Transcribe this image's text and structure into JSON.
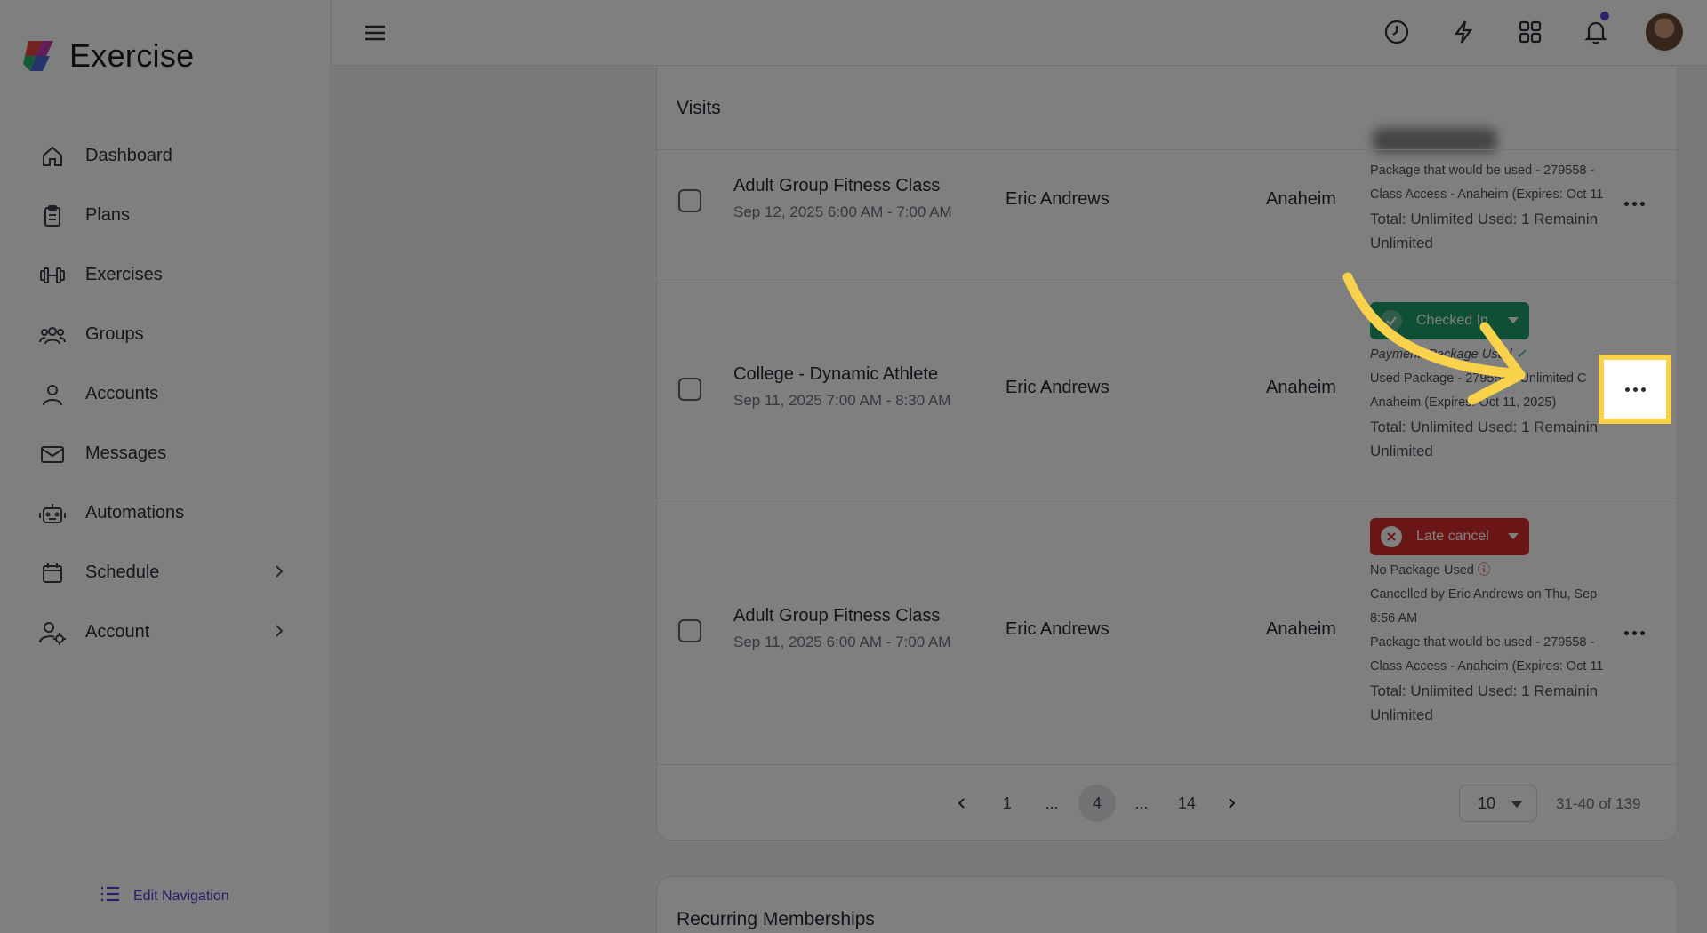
{
  "app": {
    "name": "Exercise"
  },
  "sidebar": {
    "items": [
      {
        "label": "Dashboard",
        "icon": "home-icon"
      },
      {
        "label": "Plans",
        "icon": "clipboard-icon"
      },
      {
        "label": "Exercises",
        "icon": "dumbbell-icon"
      },
      {
        "label": "Groups",
        "icon": "users-icon"
      },
      {
        "label": "Accounts",
        "icon": "user-icon"
      },
      {
        "label": "Messages",
        "icon": "mail-icon"
      },
      {
        "label": "Automations",
        "icon": "robot-icon"
      },
      {
        "label": "Schedule",
        "icon": "calendar-icon",
        "has_children": true
      },
      {
        "label": "Account",
        "icon": "user-gear-icon",
        "has_children": true
      }
    ],
    "edit_nav_label": "Edit Navigation"
  },
  "topbar": {
    "icons": [
      "clock-icon",
      "lightning-icon",
      "apps-grid-icon",
      "bell-icon"
    ],
    "notification_dot_color": "#5a4ad9"
  },
  "visits": {
    "title": "Visits",
    "rows": [
      {
        "class_name": "Adult Group Fitness Class",
        "time": "Sep 12, 2025 6:00 AM - 7:00 AM",
        "person": "Eric Andrews",
        "location": "Anaheim",
        "lines": [
          "Package that would be used - 279558 -",
          "Class Access - Anaheim (Expires: Oct 11",
          "Total: Unlimited  Used: 1  Remainin",
          "Unlimited"
        ]
      },
      {
        "class_name": "College - Dynamic Athlete",
        "time": "Sep 11, 2025 7:00 AM - 8:30 AM",
        "person": "Eric Andrews",
        "location": "Anaheim",
        "status": "Checked In",
        "status_color": "#1e9e6a",
        "payment_line": "Payment: Package Used",
        "lines": [
          "Used Package - 279558 - Unlimited C",
          "Anaheim (Expires: Oct 11, 2025)",
          "Total: Unlimited  Used: 1  Remainin",
          "Unlimited"
        ]
      },
      {
        "class_name": "Adult Group Fitness Class",
        "time": "Sep 11, 2025 6:00 AM - 7:00 AM",
        "person": "Eric Andrews",
        "location": "Anaheim",
        "status": "Late cancel",
        "status_color": "#d62c2c",
        "payment_line": "No Package Used",
        "lines": [
          "Cancelled by Eric Andrews on Thu, Sep",
          "8:56 AM",
          "Package that would be used - 279558 -",
          "Class Access - Anaheim (Expires: Oct 11",
          "Total: Unlimited  Used: 1  Remainin",
          "Unlimited"
        ]
      }
    ]
  },
  "pagination": {
    "pages": [
      "1",
      "...",
      "4",
      "...",
      "14"
    ],
    "active_page": "4",
    "per_page": "10",
    "range": "31-40 of 139"
  },
  "memberships": {
    "title": "Recurring Memberships"
  },
  "highlight": {
    "color": "#f7d24a"
  }
}
